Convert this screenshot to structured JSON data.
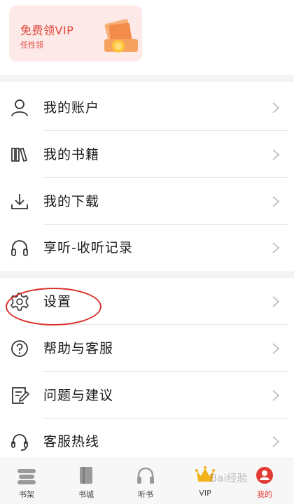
{
  "vip_card": {
    "title": "免费领VIP",
    "subtitle": "任性领"
  },
  "menu_section_1": [
    {
      "label": "我的账户",
      "icon": "person-icon"
    },
    {
      "label": "我的书籍",
      "icon": "books-icon"
    },
    {
      "label": "我的下载",
      "icon": "download-icon"
    },
    {
      "label": "享听-收听记录",
      "icon": "headphones-icon"
    }
  ],
  "menu_section_2": [
    {
      "label": "设置",
      "icon": "gear-icon"
    },
    {
      "label": "帮助与客服",
      "icon": "question-icon"
    },
    {
      "label": "问题与建议",
      "icon": "edit-note-icon"
    },
    {
      "label": "客服热线",
      "icon": "headset-icon"
    }
  ],
  "tabbar": [
    {
      "label": "书架",
      "icon": "bookshelf-icon",
      "active": false
    },
    {
      "label": "书城",
      "icon": "book-icon",
      "active": false
    },
    {
      "label": "听书",
      "icon": "headphones-icon",
      "active": false
    },
    {
      "label": "VIP",
      "icon": "crown-icon",
      "active": false
    },
    {
      "label": "我的",
      "icon": "profile-icon",
      "active": true
    }
  ],
  "watermark": "Bai经验",
  "colors": {
    "accent": "#e23b35",
    "vip_bg": "#fde9e7",
    "annotation": "#d9312b"
  }
}
